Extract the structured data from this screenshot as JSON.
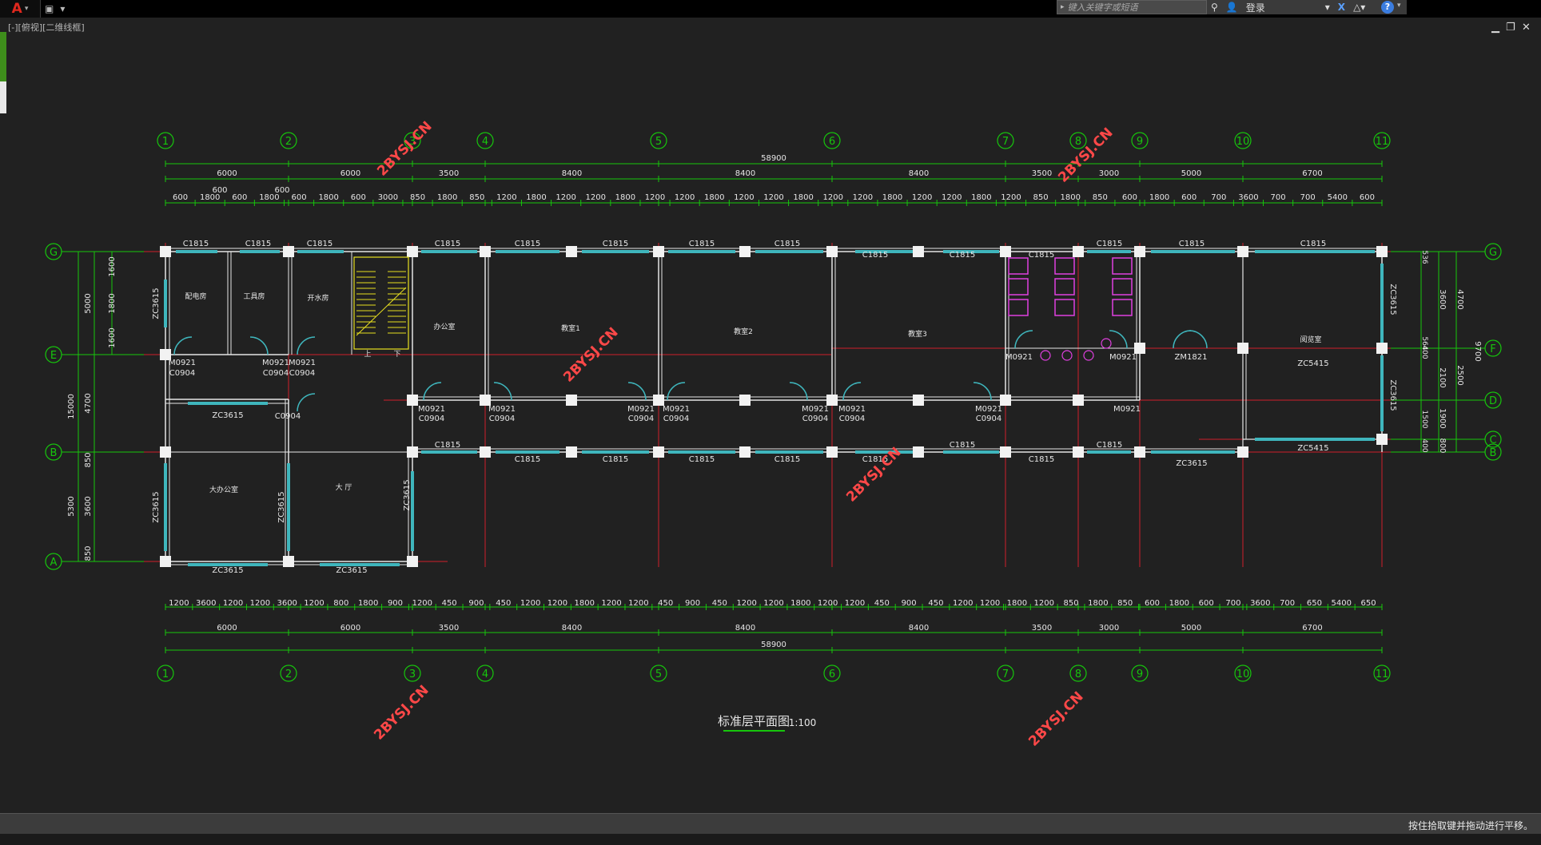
{
  "toolbar": {
    "logo": "A",
    "logo_dropdown": "▾",
    "qat_icons": [
      "save-icon",
      "dropdown-icon"
    ]
  },
  "search": {
    "placeholder": "键入关键字或短语"
  },
  "infocenter": {
    "login_label": "登录",
    "exchange": "X",
    "help": "?"
  },
  "viewport": {
    "label": "[-][俯视][二维线框]"
  },
  "status": {
    "hint": "按住拾取键并拖动进行平移。"
  },
  "colors": {
    "background": "#212121",
    "grid": "#d0202a",
    "dim": "#16c60c",
    "wall": "#e6e6e6",
    "window": "#3fb6bd",
    "stair": "#e8e020",
    "fixture": "#e040e0",
    "watermark": "#ff4848"
  },
  "drawing": {
    "title": "标准层平面图",
    "scale": "1:100",
    "columns_top": [
      "1",
      "2",
      "3",
      "4",
      "5",
      "6",
      "7",
      "8",
      "9",
      "10",
      "11"
    ],
    "columns_bottom": [
      "1",
      "2",
      "3",
      "4",
      "5",
      "6",
      "7",
      "8",
      "9",
      "10",
      "11"
    ],
    "rows_left": [
      "G",
      "E",
      "B",
      "A"
    ],
    "rows_right": [
      "G",
      "F",
      "D",
      "C",
      "B"
    ],
    "total_dim": "58900",
    "axis_dims_top": [
      "6000",
      "6000",
      "3500",
      "8400",
      "8400",
      "8400",
      "3500",
      "3000",
      "5000",
      "6700"
    ],
    "axis_dims_bottom": [
      "6000",
      "6000",
      "3500",
      "8400",
      "8400",
      "8400",
      "3500",
      "3000",
      "5000",
      "6700"
    ],
    "top_stagger": [
      "600",
      "600"
    ],
    "detail_dims_top": [
      "600",
      "1800",
      "600",
      "1800",
      "600",
      "1800",
      "600",
      "3000",
      "850",
      "1800",
      "850",
      "1200",
      "1800",
      "1200",
      "1200",
      "1800",
      "1200",
      "1200",
      "1800",
      "1200",
      "1200",
      "1800",
      "1200",
      "1200",
      "1800",
      "1200",
      "1200",
      "1800",
      "1200",
      "850",
      "1800",
      "850",
      "600",
      "1800",
      "600",
      "700",
      "3600",
      "700",
      "700",
      "5400",
      "600"
    ],
    "detail_dims_bottom": [
      "1200",
      "3600",
      "1200",
      "1200",
      "3600",
      "1200",
      "800",
      "1800",
      "900",
      "1200",
      "450",
      "900",
      "450",
      "1200",
      "1200",
      "1800",
      "1200",
      "1200",
      "450",
      "900",
      "450",
      "1200",
      "1200",
      "1800",
      "1200",
      "1200",
      "450",
      "900",
      "450",
      "1200",
      "1200",
      "1800",
      "1200",
      "850",
      "1800",
      "850",
      "600",
      "1800",
      "600",
      "700",
      "3600",
      "700",
      "650",
      "5400",
      "650"
    ],
    "left_dims_outer": [
      "15000"
    ],
    "left_dims_mid": [
      "5000",
      "4700",
      "850",
      "3600",
      "850"
    ],
    "left_dims_inner": [
      "1600",
      "1800",
      "1600"
    ],
    "left_dim_5300": "5300",
    "right_dims_inner": [
      "536",
      "564",
      "400",
      "1500",
      "400"
    ],
    "right_dims_mid": [
      "3600",
      "2100",
      "1900",
      "800"
    ],
    "right_dims_outer": [
      "4700",
      "2500"
    ],
    "right_dim_total": "9700",
    "window_labels": [
      "C1815",
      "C1815",
      "C1815",
      "C1815",
      "C1815",
      "C1815",
      "C1815",
      "C1815",
      "C1815",
      "C1815",
      "C1815",
      "C1815",
      "C1815",
      "C1815",
      "C1815",
      "C1815",
      "C1815",
      "C1815",
      "C1815",
      "C1815",
      "C1815",
      "C1815",
      "C1815",
      "ZC3615",
      "ZC5415",
      "ZC3615",
      "ZC3615",
      "ZC3615",
      "ZC3615",
      "ZC3615",
      "ZC3615",
      "ZC3615",
      "ZC5415",
      "ZC3615",
      "ZC3615"
    ],
    "door_labels": [
      "M0921",
      "C0904",
      "M0921",
      "C0904",
      "M0921",
      "C0904",
      "M0921",
      "C0904",
      "M0921",
      "C0904",
      "M0921",
      "C0904",
      "M0921",
      "C0904",
      "M0921",
      "C0904",
      "M0921",
      "C0904",
      "M0921",
      "C0904",
      "M0921",
      "M0921",
      "M0921",
      "C0904",
      "ZM1821"
    ],
    "rooms": [
      "配电房",
      "工具房",
      "开水房",
      "办公室",
      "教室1",
      "教室2",
      "教室3",
      "阅览室",
      "大办公室",
      "大 厅"
    ],
    "stair_labels": [
      "上",
      "下"
    ],
    "watermark": "2BYSJ.CN"
  }
}
